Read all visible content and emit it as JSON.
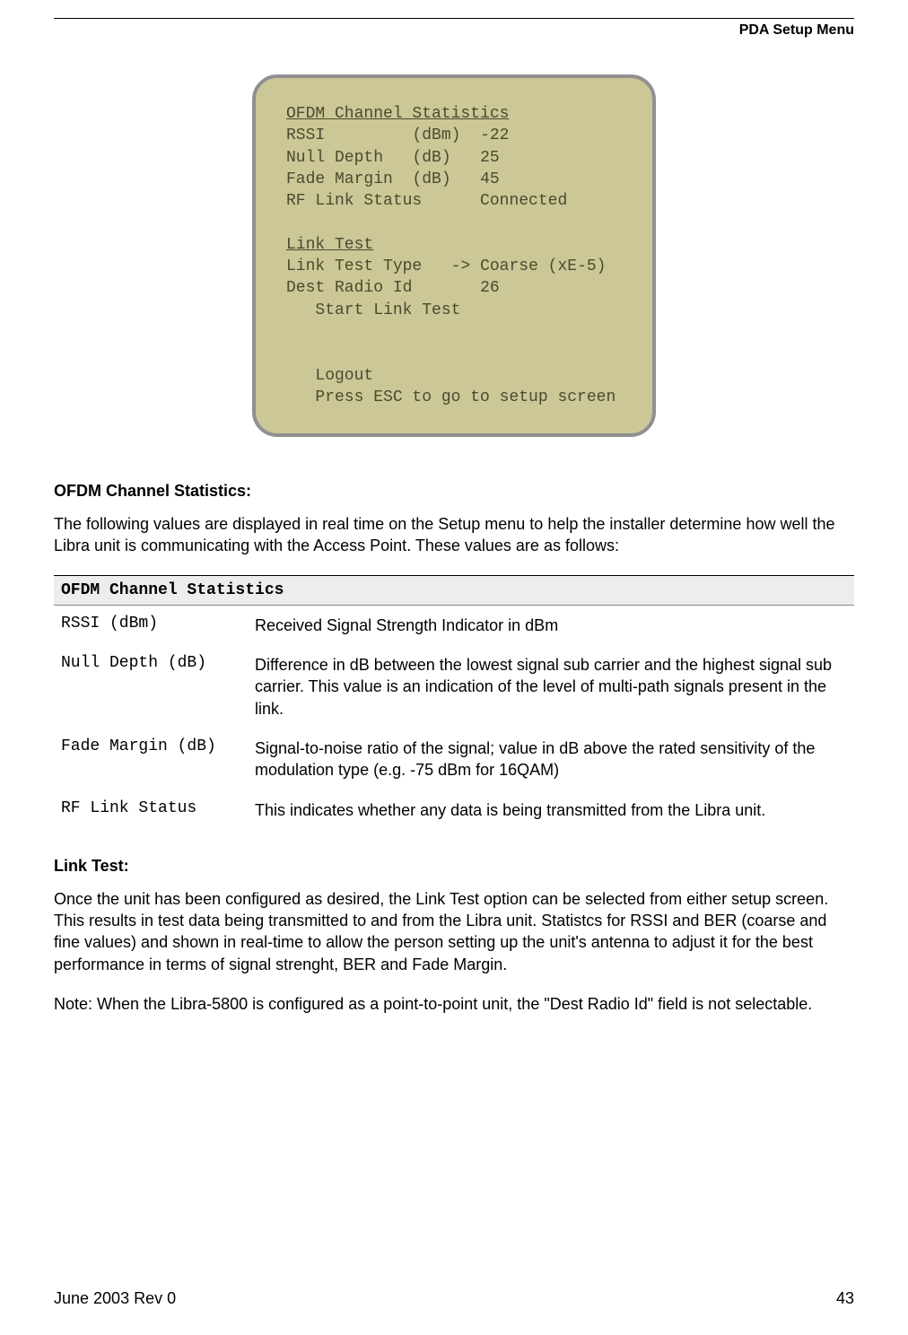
{
  "header": {
    "section": "PDA Setup Menu"
  },
  "device_screen": {
    "title": "OFDM Channel Statistics",
    "rows": [
      {
        "label": "RSSI",
        "unit": "(dBm)",
        "value": "-22"
      },
      {
        "label": "Null Depth",
        "unit": "(dB)",
        "value": "25"
      },
      {
        "label": "Fade Margin",
        "unit": "(dB)",
        "value": "45"
      },
      {
        "label": "RF Link Status",
        "unit": "",
        "value": "Connected"
      }
    ],
    "link_test_title": "Link Test",
    "link_test_rows": [
      {
        "label": "Link Test Type",
        "arrow": "->",
        "value": "Coarse (xE-5)"
      },
      {
        "label": "Dest Radio Id",
        "arrow": "",
        "value": "26"
      }
    ],
    "start_link_test": "Start Link Test",
    "logout": "Logout",
    "esc_hint": "Press ESC to go to setup screen"
  },
  "sections": {
    "ofdm_heading": "OFDM Channel Statistics:",
    "ofdm_intro": "The following values are displayed in real time on the Setup menu to help the installer determine how well the Libra unit is communicating with the Access Point. These values are as follows:",
    "table_header": "OFDM Channel Statistics",
    "table_rows": [
      {
        "term": "RSSI (dBm)",
        "desc": "Received Signal Strength Indicator in dBm"
      },
      {
        "term": "Null Depth (dB)",
        "desc": "Difference in dB between the lowest signal sub carrier and the highest signal sub carrier. This value is an indication of the level of multi-path signals present in the link."
      },
      {
        "term": "Fade Margin (dB)",
        "desc": "Signal-to-noise ratio of the signal; value in dB above the rated sensitivity of the modulation type (e.g. -75 dBm for 16QAM)"
      },
      {
        "term": "RF Link Status",
        "desc": "This indicates whether any data is being transmitted from the Libra unit."
      }
    ],
    "link_test_heading": "Link Test:",
    "link_test_body": "Once the unit has been configured as desired, the Link Test option can be selected from either setup screen. This results in test data being transmitted to and from the Libra unit. Statistcs for RSSI and BER (coarse and fine values) and shown in real-time to allow the person setting up the unit's antenna to adjust it for the best performance in terms of signal strenght, BER and Fade Margin.",
    "note": "Note: When the Libra-5800 is configured as a point-to-point unit, the \"Dest Radio Id\" field is not selectable."
  },
  "footer": {
    "left": "June 2003 Rev 0",
    "right": "43"
  }
}
